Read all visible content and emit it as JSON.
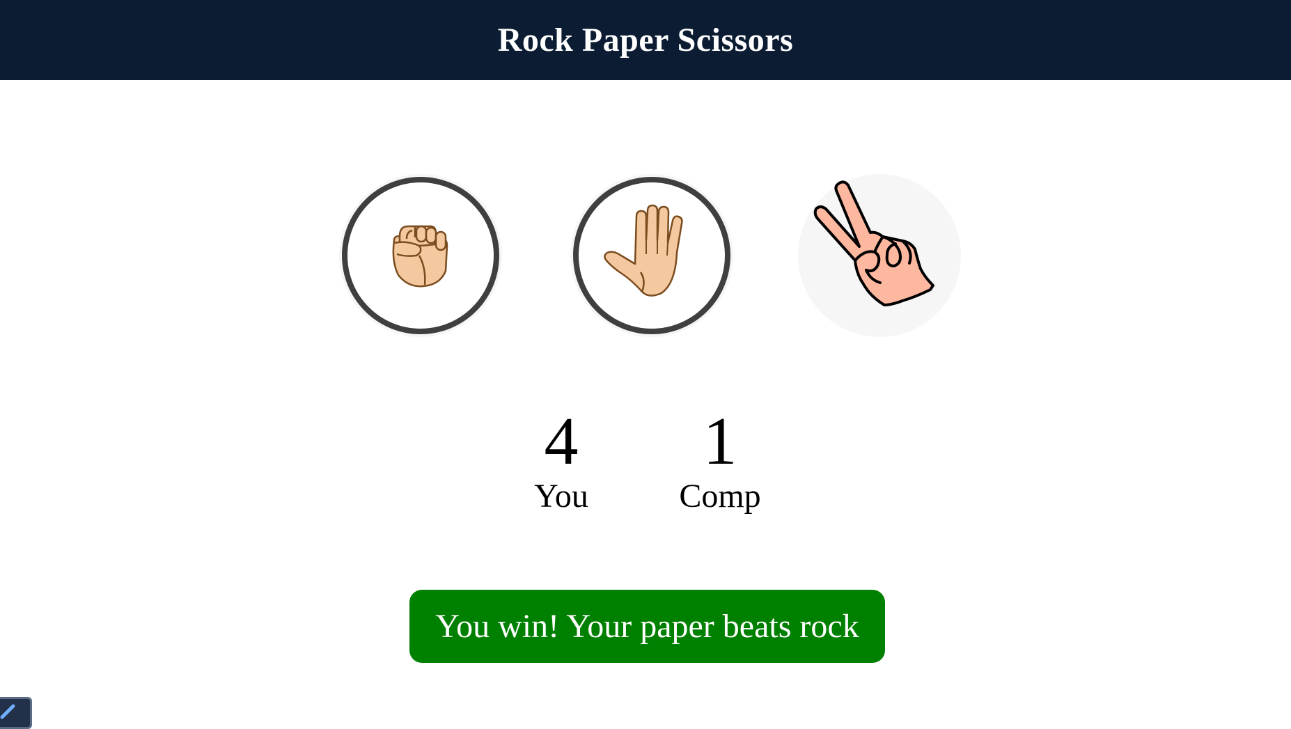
{
  "header": {
    "title": "Rock Paper Scissors"
  },
  "choices": [
    {
      "name": "rock",
      "icon": "rock-fist-icon"
    },
    {
      "name": "paper",
      "icon": "paper-hand-icon"
    },
    {
      "name": "scissors",
      "icon": "scissors-hand-icon"
    }
  ],
  "scores": {
    "user": {
      "value": "4",
      "label": "You"
    },
    "comp": {
      "value": "1",
      "label": "Comp"
    }
  },
  "result": {
    "message": "You win! Your paper beats rock",
    "color": "#008000"
  },
  "colors": {
    "header_bg": "#0b1c33",
    "ring": "#3f3f3f",
    "skin": "#f4c9a0",
    "skin_outline": "#7a4b1d"
  }
}
